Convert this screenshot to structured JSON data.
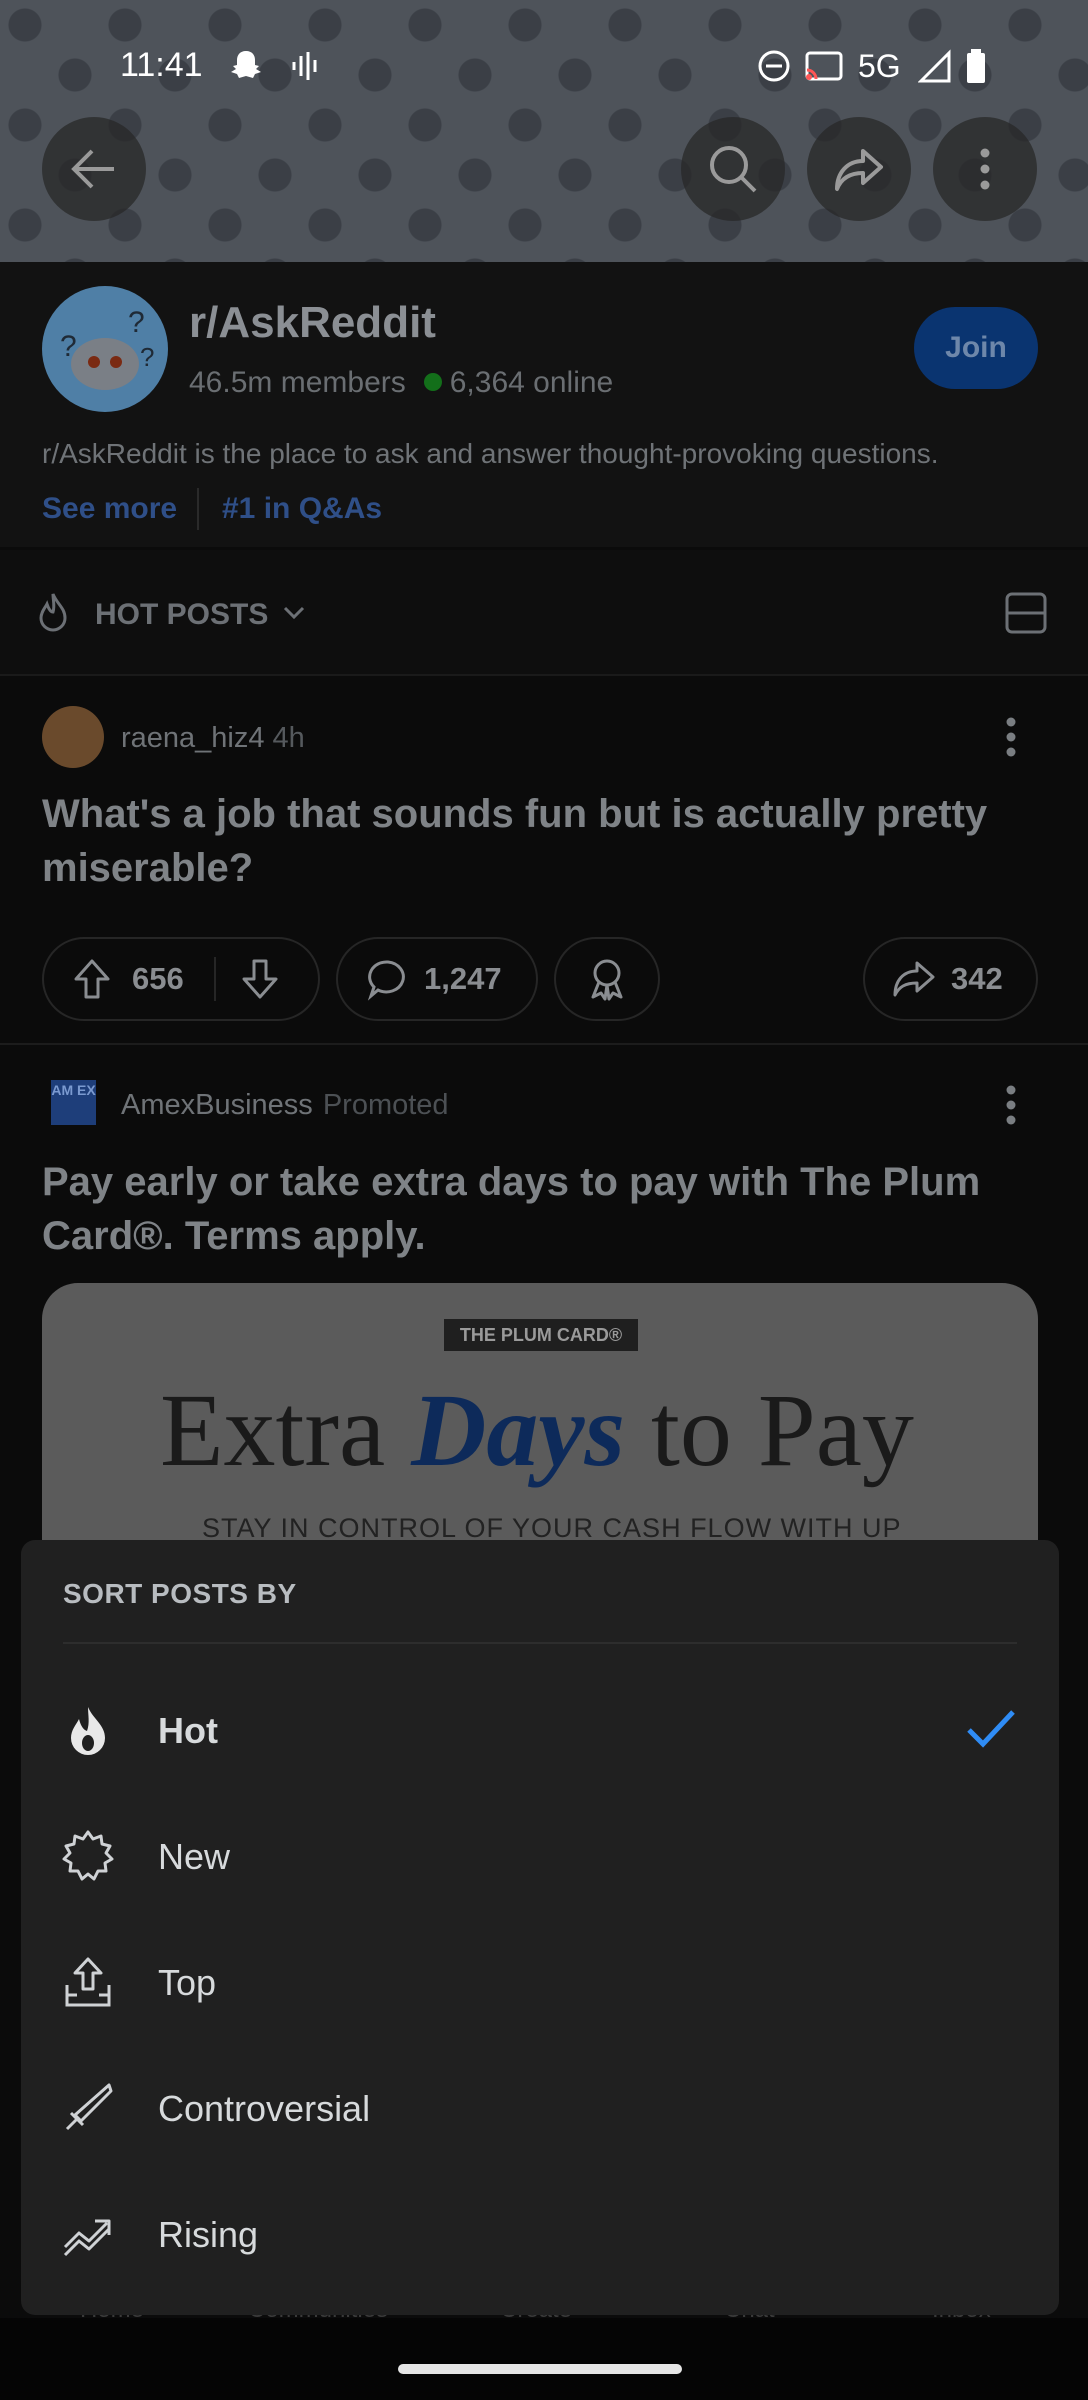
{
  "status_bar": {
    "time": "11:41",
    "network": "5G"
  },
  "subreddit": {
    "name": "r/AskReddit",
    "members": "46.5m members",
    "online": "6,364 online",
    "join_label": "Join",
    "description": "r/AskReddit is the place to ask and answer thought-provoking questions.",
    "see_more": "See more",
    "rank": "#1 in Q&As"
  },
  "sort_bar": {
    "label": "HOT POSTS"
  },
  "posts": [
    {
      "author": "raena_hiz4",
      "age": "4h",
      "title": "What's a job that sounds fun but is actually pretty miserable?",
      "upvotes": "656",
      "comments": "1,247",
      "shares": "342"
    }
  ],
  "ad": {
    "logo_text": "AM EX",
    "advertiser": "AmexBusiness",
    "promoted_label": "Promoted",
    "title": "Pay early or take extra days to pay with The Plum Card®. Terms apply.",
    "tag": "THE PLUM CARD®",
    "headline_a": "Extra ",
    "headline_b": "Days",
    "headline_c": " to Pay",
    "subline": "STAY IN CONTROL OF YOUR CASH FLOW WITH UP"
  },
  "bottom_nav_peek": [
    "Home",
    "Communities",
    "Create",
    "Chat",
    "Inbox"
  ],
  "sort_sheet": {
    "title": "SORT POSTS BY",
    "selected": "Hot",
    "options": [
      {
        "label": "Hot",
        "icon": "flame-icon"
      },
      {
        "label": "New",
        "icon": "burst-icon"
      },
      {
        "label": "Top",
        "icon": "top-upload-icon"
      },
      {
        "label": "Controversial",
        "icon": "sword-icon"
      },
      {
        "label": "Rising",
        "icon": "trending-up-icon"
      }
    ],
    "check_color": "#2f8cf5"
  }
}
